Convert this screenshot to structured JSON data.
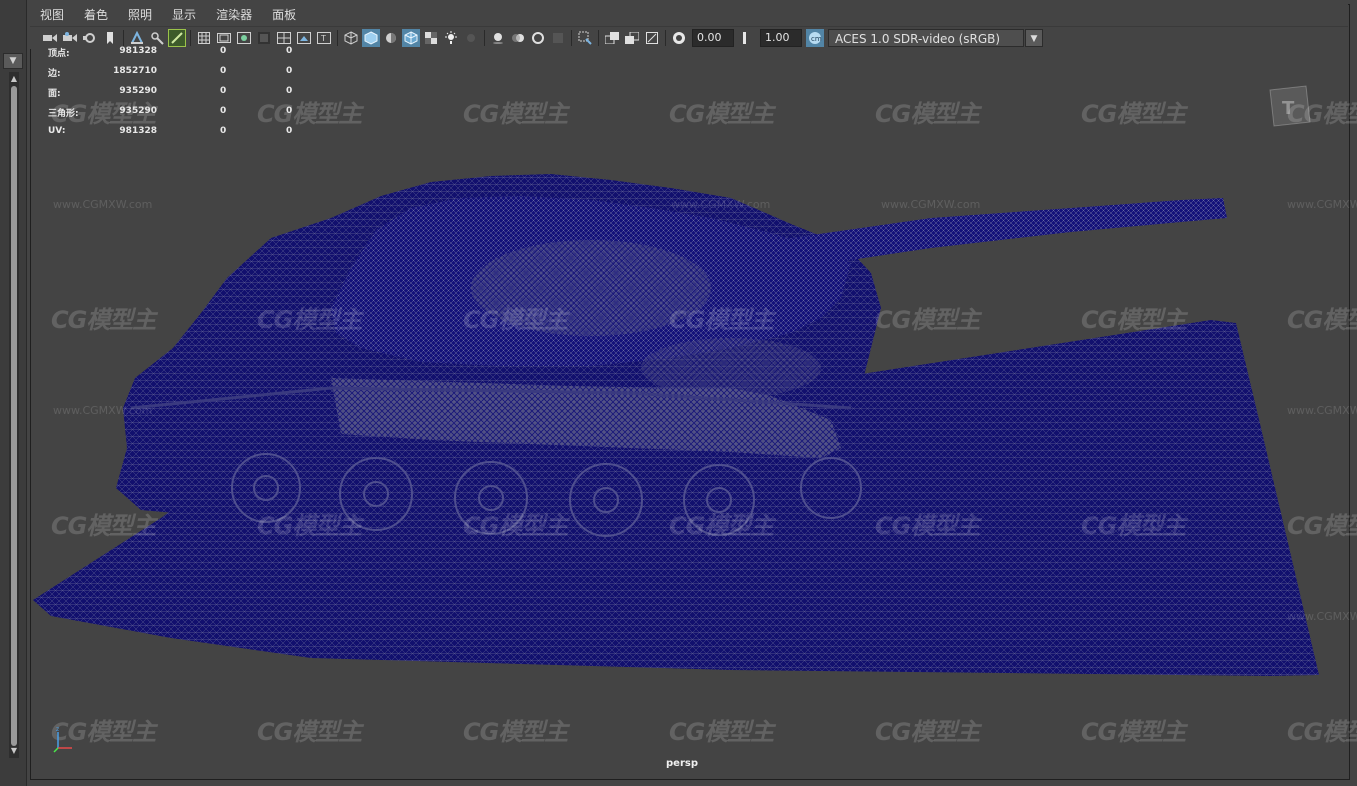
{
  "menu": {
    "items": [
      "视图",
      "着色",
      "照明",
      "显示",
      "渲染器",
      "面板"
    ]
  },
  "toolbar": {
    "gamma_value": "0.00",
    "exposure_value": "1.00",
    "color_space": "ACES 1.0 SDR-video (sRGB)",
    "icons": [
      "camera-select-icon",
      "camera-attributes-icon",
      "bookmark-icon",
      "image-plane-icon",
      "grid-icon",
      "film-gate-icon",
      "resolution-gate-icon",
      "gate-mask-icon",
      "field-chart-icon",
      "safe-action-icon",
      "safe-title-icon",
      "wireframe-icon",
      "smooth-shade-icon",
      "use-default-material-icon",
      "wireframe-on-shaded-icon",
      "xray-icon",
      "textured-icon",
      "use-all-lights-icon",
      "shadows-icon",
      "screen-space-ambient-occlusion-icon",
      "motion-blur-icon",
      "anti-aliasing-icon",
      "depth-of-field-icon",
      "isolate-select-icon",
      "xray-joints-icon",
      "xray-active-components-icon",
      "backface-culling-icon"
    ]
  },
  "hud": {
    "rows": [
      {
        "label": "顶点:",
        "v1": "981328",
        "v2": "0",
        "v3": "0"
      },
      {
        "label": "边:",
        "v1": "1852710",
        "v2": "0",
        "v3": "0"
      },
      {
        "label": "面:",
        "v1": "935290",
        "v2": "0",
        "v3": "0"
      },
      {
        "label": "三角形:",
        "v1": "935290",
        "v2": "0",
        "v3": "0"
      },
      {
        "label": "UV:",
        "v1": "981328",
        "v2": "0",
        "v3": "0"
      }
    ]
  },
  "viewport": {
    "camera": "persp",
    "mesh_color": "#12106e",
    "background": "#444444",
    "watermark_text": "CG模型主",
    "watermark_url": "www.CGMXW.com"
  },
  "colors": {
    "accent_active": "#5285a6",
    "highlight_outline": "#9bc34a"
  }
}
